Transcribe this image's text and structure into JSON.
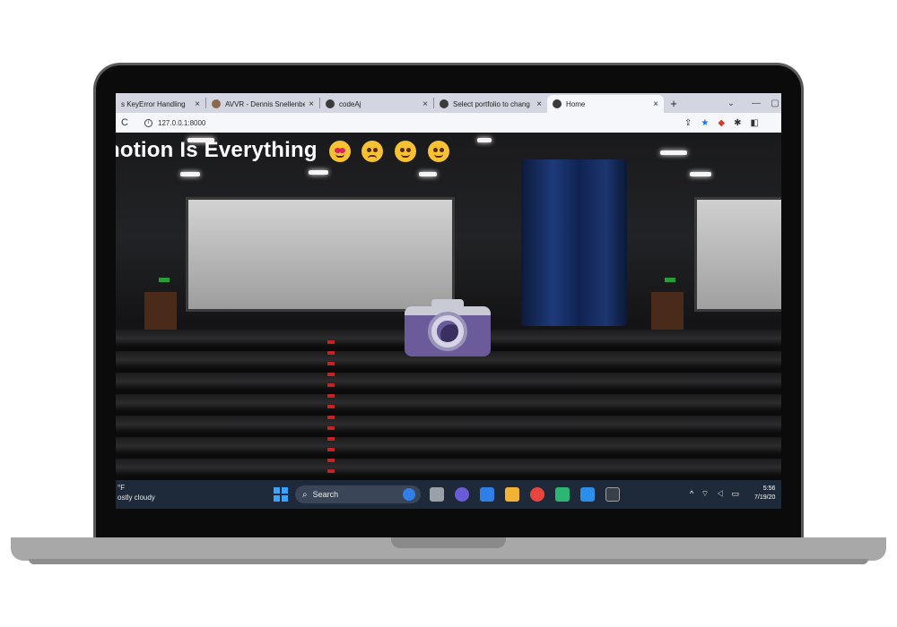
{
  "browser": {
    "tabs": [
      {
        "title": "s KeyError Handling",
        "active": false
      },
      {
        "title": "AVVR - Dennis Snellenbe",
        "active": false
      },
      {
        "title": "codeAj",
        "active": false
      },
      {
        "title": "Select portfolio to chang",
        "active": false
      },
      {
        "title": "Home",
        "active": true
      }
    ],
    "tab_close": "×",
    "new_tab": "+",
    "window_controls": [
      "⌄",
      "—",
      "▢"
    ],
    "reload": "C",
    "url": "127.0.0.1:8000",
    "info_icon": "i"
  },
  "page": {
    "title": "notion Is Everything",
    "emojis": [
      "star-struck-emoji",
      "sad-emoji",
      "smiling-emoji",
      "laughing-emoji"
    ],
    "camera": "camera-icon",
    "background": "cinema-auditorium"
  },
  "taskbar": {
    "weather_temp": "°F",
    "weather_desc": "ostly cloudy",
    "search_label": "Search",
    "time": "5:56",
    "date": "7/19/20",
    "tray_icons": "^ ⌔ ◁ ▭"
  },
  "colors": {
    "accent": "#6b5b9a",
    "taskbar": "#1e2a3a",
    "tabstrip": "#d3d6e0"
  }
}
